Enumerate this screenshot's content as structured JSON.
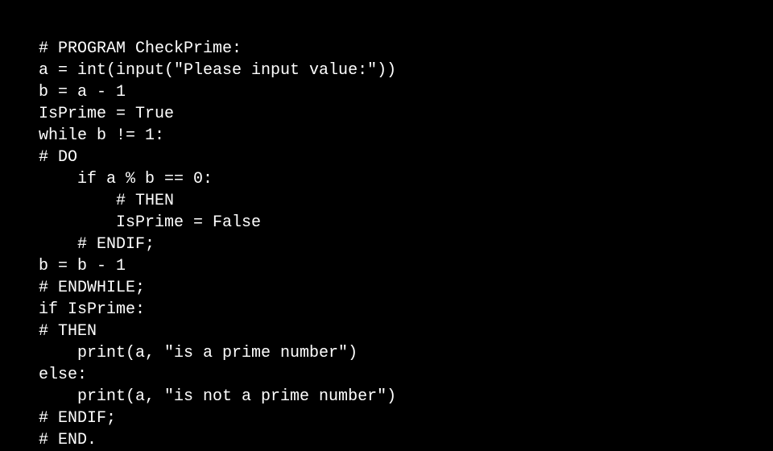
{
  "code": {
    "lines": [
      "# PROGRAM CheckPrime:",
      "a = int(input(\"Please input value:\"))",
      "b = a - 1",
      "IsPrime = True",
      "while b != 1:",
      "# DO",
      "    if a % b == 0:",
      "        # THEN",
      "        IsPrime = False",
      "    # ENDIF;",
      "b = b - 1",
      "# ENDWHILE;",
      "if IsPrime:",
      "# THEN",
      "    print(a, \"is a prime number\")",
      "else:",
      "    print(a, \"is not a prime number\")",
      "# ENDIF;",
      "# END."
    ]
  }
}
